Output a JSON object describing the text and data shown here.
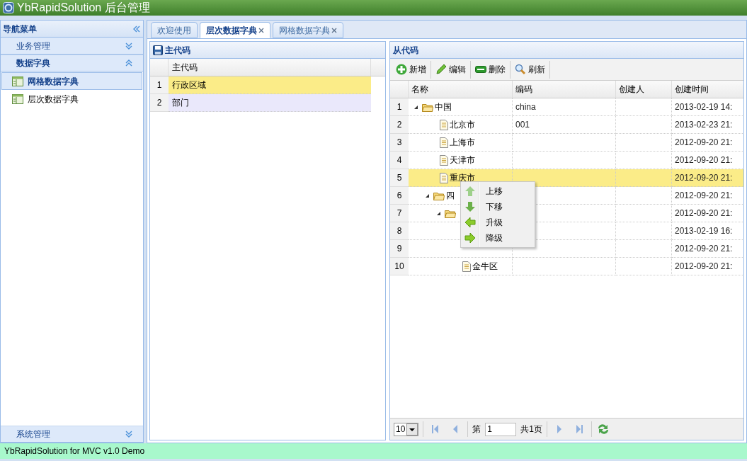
{
  "header": {
    "title": "YbRapidSolution 后台管理"
  },
  "sidebar": {
    "title": "导航菜单",
    "groups": [
      {
        "title": "业务管理",
        "expanded": false
      },
      {
        "title": "数据字典",
        "expanded": true,
        "items": [
          {
            "label": "网格数据字典",
            "selected": true
          },
          {
            "label": "层次数据字典",
            "selected": false
          }
        ]
      },
      {
        "title": "系统管理",
        "expanded": false
      }
    ]
  },
  "tabs": [
    {
      "label": "欢迎使用",
      "selected": false,
      "closable": false
    },
    {
      "label": "层次数据字典",
      "selected": true,
      "closable": true
    },
    {
      "label": "网格数据字典",
      "selected": false,
      "closable": true
    }
  ],
  "master": {
    "title": "主代码",
    "columns": [
      "主代码"
    ],
    "rows": [
      {
        "number": "1",
        "value": "行政区域",
        "selected": true,
        "hovered": false
      },
      {
        "number": "2",
        "value": "部门",
        "selected": false,
        "hovered": true
      }
    ]
  },
  "detail": {
    "title": "从代码",
    "toolbar": [
      {
        "label": "新增"
      },
      {
        "label": "编辑"
      },
      {
        "label": "删除"
      },
      {
        "label": "刷新"
      }
    ],
    "columns": [
      "名称",
      "编码",
      "创建人",
      "创建时间"
    ],
    "rows": [
      {
        "number": "1",
        "name": "中国",
        "code": "china",
        "time": "2013-02-19 14:",
        "selected": false,
        "expanded": true,
        "children": [
          {
            "number": "2",
            "name": "北京市",
            "code": "001",
            "time": "2013-02-23 21:",
            "selected": false
          },
          {
            "number": "3",
            "name": "上海市",
            "time": "2012-09-20 21:",
            "selected": false
          },
          {
            "number": "4",
            "name": "天津市",
            "time": "2012-09-20 21:",
            "selected": false
          },
          {
            "number": "5",
            "name": "重庆市",
            "time": "2012-09-20 21:",
            "selected": true
          },
          {
            "number": "6",
            "name": "四",
            "time": "2012-09-20 21:",
            "selected": false,
            "expanded": true,
            "children": [
              {
                "number": "7",
                "time": "2012-09-20 21:",
                "selected": false,
                "expanded": true,
                "children": [
                  {
                    "number": "8",
                    "time": "2013-02-19 16:",
                    "selected": false
                  },
                  {
                    "number": "9",
                    "time": "2012-09-20 21:",
                    "selected": false
                  },
                  {
                    "number": "10",
                    "name": "金牛区",
                    "time": "2012-09-20 21:",
                    "selected": false
                  }
                ]
              }
            ]
          }
        ]
      }
    ],
    "pager": {
      "page_size": "10",
      "page_prefix": "第",
      "page": "1",
      "total": "共1页"
    },
    "context_menu": [
      {
        "label": "上移"
      },
      {
        "label": "下移"
      },
      {
        "label": "升级"
      },
      {
        "label": "降级"
      }
    ]
  },
  "status_bar": {
    "text": "YbRapidSolution for MVC v1.0 Demo"
  }
}
